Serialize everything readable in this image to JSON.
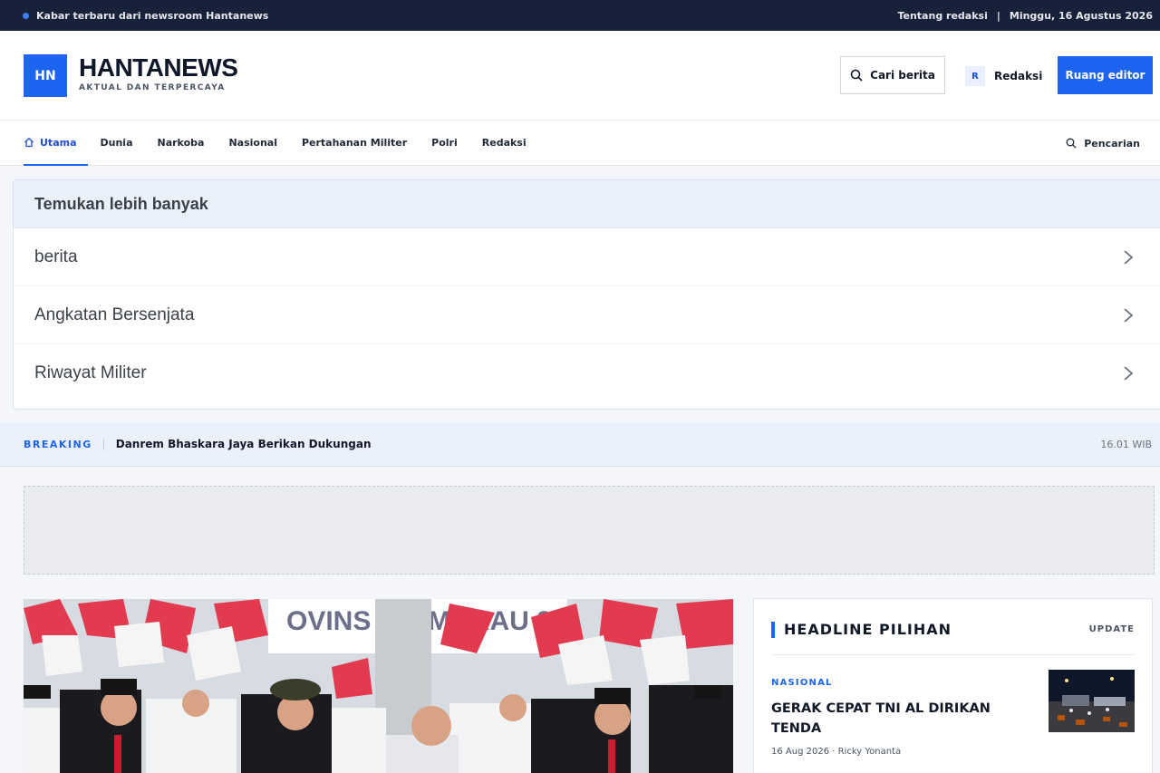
{
  "topbar": {
    "message": "Kabar terbaru dari newsroom Hantanews",
    "about": "Tentang redaksi",
    "separator": "|",
    "date": "Minggu, 16 Agustus 2026"
  },
  "header": {
    "logo_initials": "HN",
    "brand_name": "HANTANEWS",
    "tagline": "AKTUAL DAN TERPERCAYA",
    "search_button": "Cari berita",
    "redaksi_badge": "R",
    "redaksi_button": "Redaksi",
    "editor_button": "Ruang editor"
  },
  "nav": {
    "items": [
      {
        "label": "Utama",
        "icon": "home-icon",
        "active": true
      },
      {
        "label": "Dunia"
      },
      {
        "label": "Narkoba"
      },
      {
        "label": "Nasional"
      },
      {
        "label": "Pertahanan Militer"
      },
      {
        "label": "Polri"
      },
      {
        "label": "Redaksi"
      }
    ],
    "search_label": "Pencarian"
  },
  "discover": {
    "title": "Temukan lebih banyak",
    "items": [
      "berita",
      "Angkatan Bersenjata",
      "Riwayat Militer"
    ]
  },
  "breaking": {
    "tag": "BREAKING",
    "text": "Danrem Bhaskara Jaya Berikan Dukungan",
    "time": "16.01 WIB"
  },
  "hero": {
    "banner_text": "OVINS A TIMURAU 2"
  },
  "headline_panel": {
    "title": "HEADLINE PILIHAN",
    "update_label": "UPDATE",
    "story": {
      "category": "NASIONAL",
      "title": "GERAK CEPAT TNI AL DIRIKAN TENDA",
      "meta": "16 Aug 2026 · Ricky Yonanta"
    }
  },
  "colors": {
    "accent": "#1d64f0",
    "topbar_bg": "#17213a",
    "breaking_bg": "#eaf1fd"
  }
}
